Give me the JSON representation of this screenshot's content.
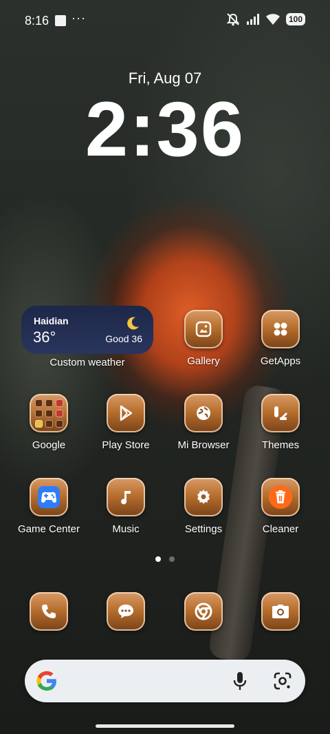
{
  "status_bar": {
    "time": "8:16",
    "overflow": "···",
    "battery": "100",
    "icons": [
      "notification-square-icon",
      "mute-icon",
      "signal-icon",
      "wifi-icon",
      "battery-icon"
    ]
  },
  "lock": {
    "date": "Fri, Aug 07",
    "time": "2:36"
  },
  "weather_widget": {
    "city": "Haidian",
    "temperature": "36°",
    "air_quality": "Good 36",
    "icon": "moon-icon",
    "label": "Custom weather"
  },
  "apps": [
    {
      "label": "Gallery",
      "icon": "gallery-icon"
    },
    {
      "label": "GetApps",
      "icon": "getapps-icon"
    },
    {
      "label": "Google",
      "icon": "folder-icon"
    },
    {
      "label": "Play Store",
      "icon": "play-store-icon"
    },
    {
      "label": "Mi Browser",
      "icon": "globe-icon"
    },
    {
      "label": "Themes",
      "icon": "themes-icon"
    },
    {
      "label": "Game Center",
      "icon": "gamepad-icon"
    },
    {
      "label": "Music",
      "icon": "music-note-icon"
    },
    {
      "label": "Settings",
      "icon": "gear-icon"
    },
    {
      "label": "Cleaner",
      "icon": "trash-icon"
    }
  ],
  "dock": [
    "phone-icon",
    "messages-icon",
    "chrome-icon",
    "camera-icon"
  ],
  "pager": {
    "pages": 2,
    "active": 1
  },
  "colors": {
    "tile_top": "#d99b68",
    "tile_bottom": "#7a4218",
    "weather_bg": "#1d2748",
    "gamecenter_blue": "#2f7df6",
    "cleaner_orange": "#ff6a1a",
    "search_bg": "#eceff1"
  }
}
